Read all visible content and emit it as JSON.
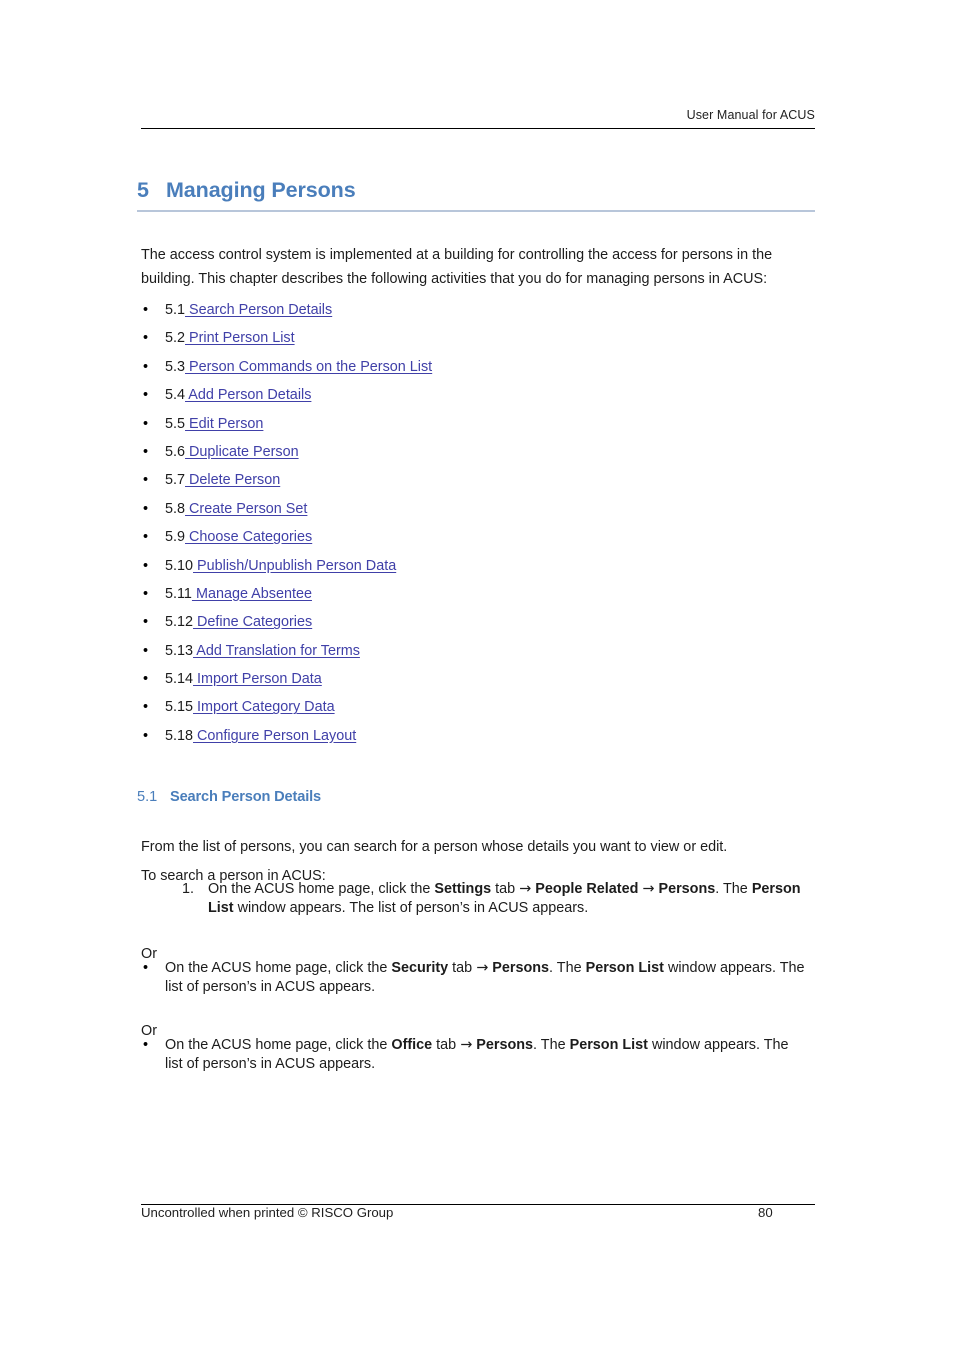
{
  "header": {
    "text": "User Manual for ACUS"
  },
  "chapter": {
    "number": "5",
    "title": "Managing Persons"
  },
  "intro": {
    "paragraph": "The access control system is implemented at a building for controlling the access for persons in the building. This chapter describes the following activities that you do for managing persons in ACUS:"
  },
  "toc": {
    "bullet_glyph": "•",
    "items": [
      {
        "number": "5.1",
        "link": " Search Person Details"
      },
      {
        "number": "5.2",
        "link": " Print Person List"
      },
      {
        "number": "5.3",
        "link": " Person Commands on the Person List"
      },
      {
        "number": "5.4",
        "link": " Add Person Details"
      },
      {
        "number": "5.5",
        "link": " Edit Person"
      },
      {
        "number": "5.6",
        "link": " Duplicate Person"
      },
      {
        "number": "5.7",
        "link": " Delete Person"
      },
      {
        "number": "5.8",
        "link": " Create Person Set"
      },
      {
        "number": "5.9",
        "link": " Choose Categories"
      },
      {
        "number": "5.10",
        "link": " Publish/Unpublish Person Data"
      },
      {
        "number": "5.11",
        "link": " Manage Absentee"
      },
      {
        "number": "5.12",
        "link": " Define Categories"
      },
      {
        "number": "5.13",
        "link": " Add Translation for Terms"
      },
      {
        "number": "5.14",
        "link": " Import Person Data"
      },
      {
        "number": "5.15",
        "link": " Import Category Data"
      },
      {
        "number": "5.18",
        "link": " Configure Person Layout"
      }
    ]
  },
  "section": {
    "number": "5.1",
    "title": "Search Person Details",
    "intro": "From the list of persons, you can search for a person whose details you want to view or edit.",
    "lead_in": "To search a person in ACUS:",
    "or_label_1": "Or",
    "or_label_2": "Or",
    "step": {
      "marker": "1.",
      "t1": "On the ACUS home page, click the ",
      "b1": "Settings",
      "t2": " tab ",
      "arrow1": "→",
      "b2": " People Related ",
      "arrow2": "→",
      "b3": " Persons",
      "t3": ". The ",
      "b4": "Person List",
      "t4": " window appears. The list of person’s in ACUS appears."
    },
    "alt_security": {
      "bullet_glyph": "•",
      "t1": "On the ACUS home page, click the ",
      "b1": "Security",
      "t2": " tab ",
      "arrow1": "→",
      "b2": " Persons",
      "t3": ". The ",
      "b3": "Person List",
      "t4": " window appears. The list of person’s in ACUS appears."
    },
    "alt_office": {
      "bullet_glyph": "•",
      "t1": "On the ACUS home page, click the ",
      "b1": "Office",
      "t2": " tab ",
      "arrow1": "→",
      "b2": " Persons",
      "t3": ". The ",
      "b3": "Person List",
      "t4": " window appears. The list of person’s in ACUS appears."
    }
  },
  "footer": {
    "left": "Uncontrolled when printed © RISCO Group",
    "page_number": "80"
  },
  "colors": {
    "heading_blue": "#4a7ebb",
    "link_blue": "#4040a8",
    "heading_rule": "#b8c6da",
    "body_text": "#1c1c1c"
  }
}
